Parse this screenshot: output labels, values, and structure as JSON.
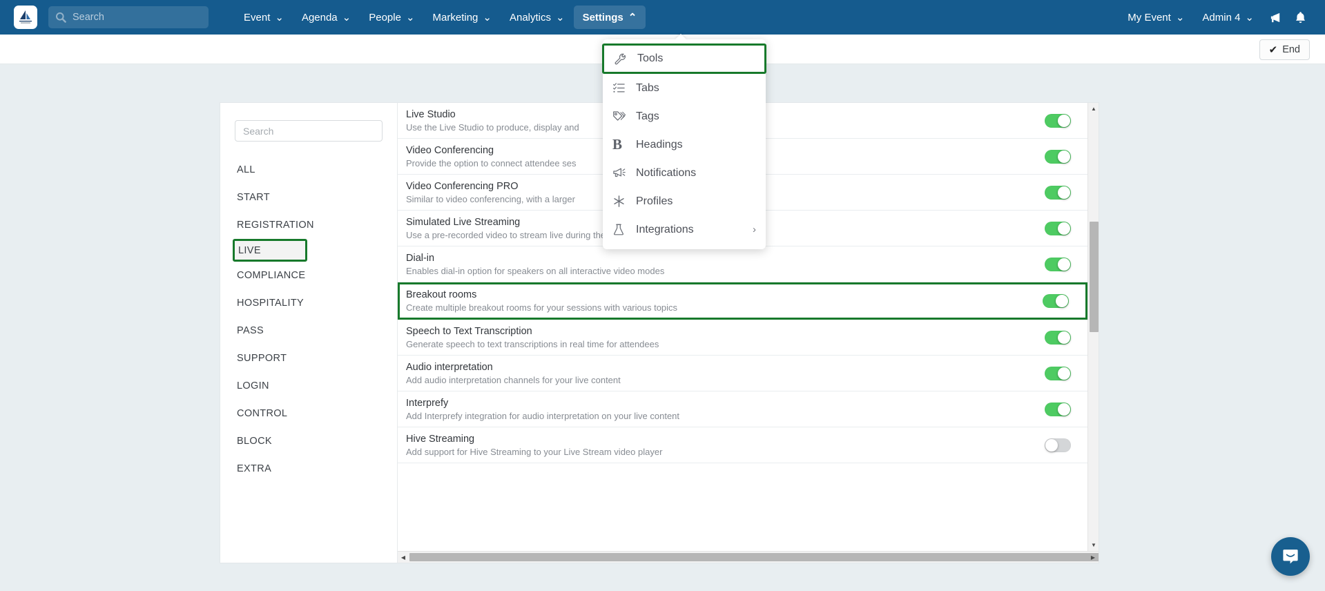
{
  "topnav": {
    "logo_alt": "event-platform-logo",
    "search_placeholder": "Search",
    "search_value": "",
    "items": [
      {
        "label": "Event",
        "caret": "⌄"
      },
      {
        "label": "Agenda",
        "caret": "⌄"
      },
      {
        "label": "People",
        "caret": "⌄"
      },
      {
        "label": "Marketing",
        "caret": "⌄"
      },
      {
        "label": "Analytics",
        "caret": "⌄"
      },
      {
        "label": "Settings",
        "caret": "⌃"
      }
    ],
    "right_items": [
      {
        "label": "My Event",
        "caret": "⌄"
      },
      {
        "label": "Admin 4",
        "caret": "⌄"
      }
    ],
    "announce_icon": "megaphone-icon",
    "bell_icon": "bell-icon"
  },
  "subbar": {
    "end_label": "End",
    "end_check": "✔"
  },
  "dropdown": {
    "items": [
      {
        "label": "Tools",
        "icon": "wrench-icon",
        "highlighted": true
      },
      {
        "label": "Tabs",
        "icon": "checklist-icon",
        "highlighted": false
      },
      {
        "label": "Tags",
        "icon": "tags-icon",
        "highlighted": false
      },
      {
        "label": "Headings",
        "icon": "bold-b-icon",
        "highlighted": false
      },
      {
        "label": "Notifications",
        "icon": "megaphone-icon",
        "highlighted": false
      },
      {
        "label": "Profiles",
        "icon": "asterisk-icon",
        "highlighted": false
      },
      {
        "label": "Integrations",
        "icon": "flask-icon",
        "highlighted": false,
        "submenu_caret": "›"
      }
    ],
    "highlight_color": "#17792b"
  },
  "sidebar": {
    "search_placeholder": "Search",
    "search_value": "",
    "items": [
      {
        "label": "ALL",
        "active": false
      },
      {
        "label": "START",
        "active": false
      },
      {
        "label": "REGISTRATION",
        "active": false
      },
      {
        "label": "LIVE",
        "active": true
      },
      {
        "label": "COMPLIANCE",
        "active": false
      },
      {
        "label": "HOSPITALITY",
        "active": false
      },
      {
        "label": "PASS",
        "active": false
      },
      {
        "label": "SUPPORT",
        "active": false
      },
      {
        "label": "LOGIN",
        "active": false
      },
      {
        "label": "CONTROL",
        "active": false
      },
      {
        "label": "BLOCK",
        "active": false
      },
      {
        "label": "EXTRA",
        "active": false
      }
    ]
  },
  "settings_list": {
    "rows": [
      {
        "title": "Live Studio",
        "desc": "Use the Live Studio to produce, display and",
        "enabled": true,
        "highlighted": false
      },
      {
        "title": "Video Conferencing",
        "desc": "Provide the option to connect attendee ses",
        "enabled": true,
        "highlighted": false
      },
      {
        "title": "Video Conferencing PRO",
        "desc": "Similar to video conferencing, with a larger",
        "enabled": true,
        "highlighted": false
      },
      {
        "title": "Simulated Live Streaming",
        "desc": "Use a pre-recorded video to stream live during the session dates automatically",
        "enabled": true,
        "highlighted": false
      },
      {
        "title": "Dial-in",
        "desc": "Enables dial-in option for speakers on all interactive video modes",
        "enabled": true,
        "highlighted": false
      },
      {
        "title": "Breakout rooms",
        "desc": "Create multiple breakout rooms for your sessions with various topics",
        "enabled": true,
        "highlighted": true
      },
      {
        "title": "Speech to Text Transcription",
        "desc": "Generate speech to text transcriptions in real time for attendees",
        "enabled": true,
        "highlighted": false
      },
      {
        "title": "Audio interpretation",
        "desc": "Add audio interpretation channels for your live content",
        "enabled": true,
        "highlighted": false
      },
      {
        "title": "Interprefy",
        "desc": "Add Interprefy integration for audio interpretation on your live content",
        "enabled": true,
        "highlighted": false
      },
      {
        "title": "Hive Streaming",
        "desc": "Add support for Hive Streaming to your Live Stream video player",
        "enabled": false,
        "highlighted": false
      }
    ]
  },
  "scrollbars": {
    "v_up": "▲",
    "v_down": "▼",
    "h_left": "◀",
    "h_right": "▶"
  },
  "intercom": {
    "icon": "chat-bubble-icon"
  },
  "colors": {
    "nav_blue": "#155b8e",
    "toggle_on": "#4ecb62",
    "toggle_off": "#d4d6d8",
    "highlight_green": "#17792b"
  }
}
